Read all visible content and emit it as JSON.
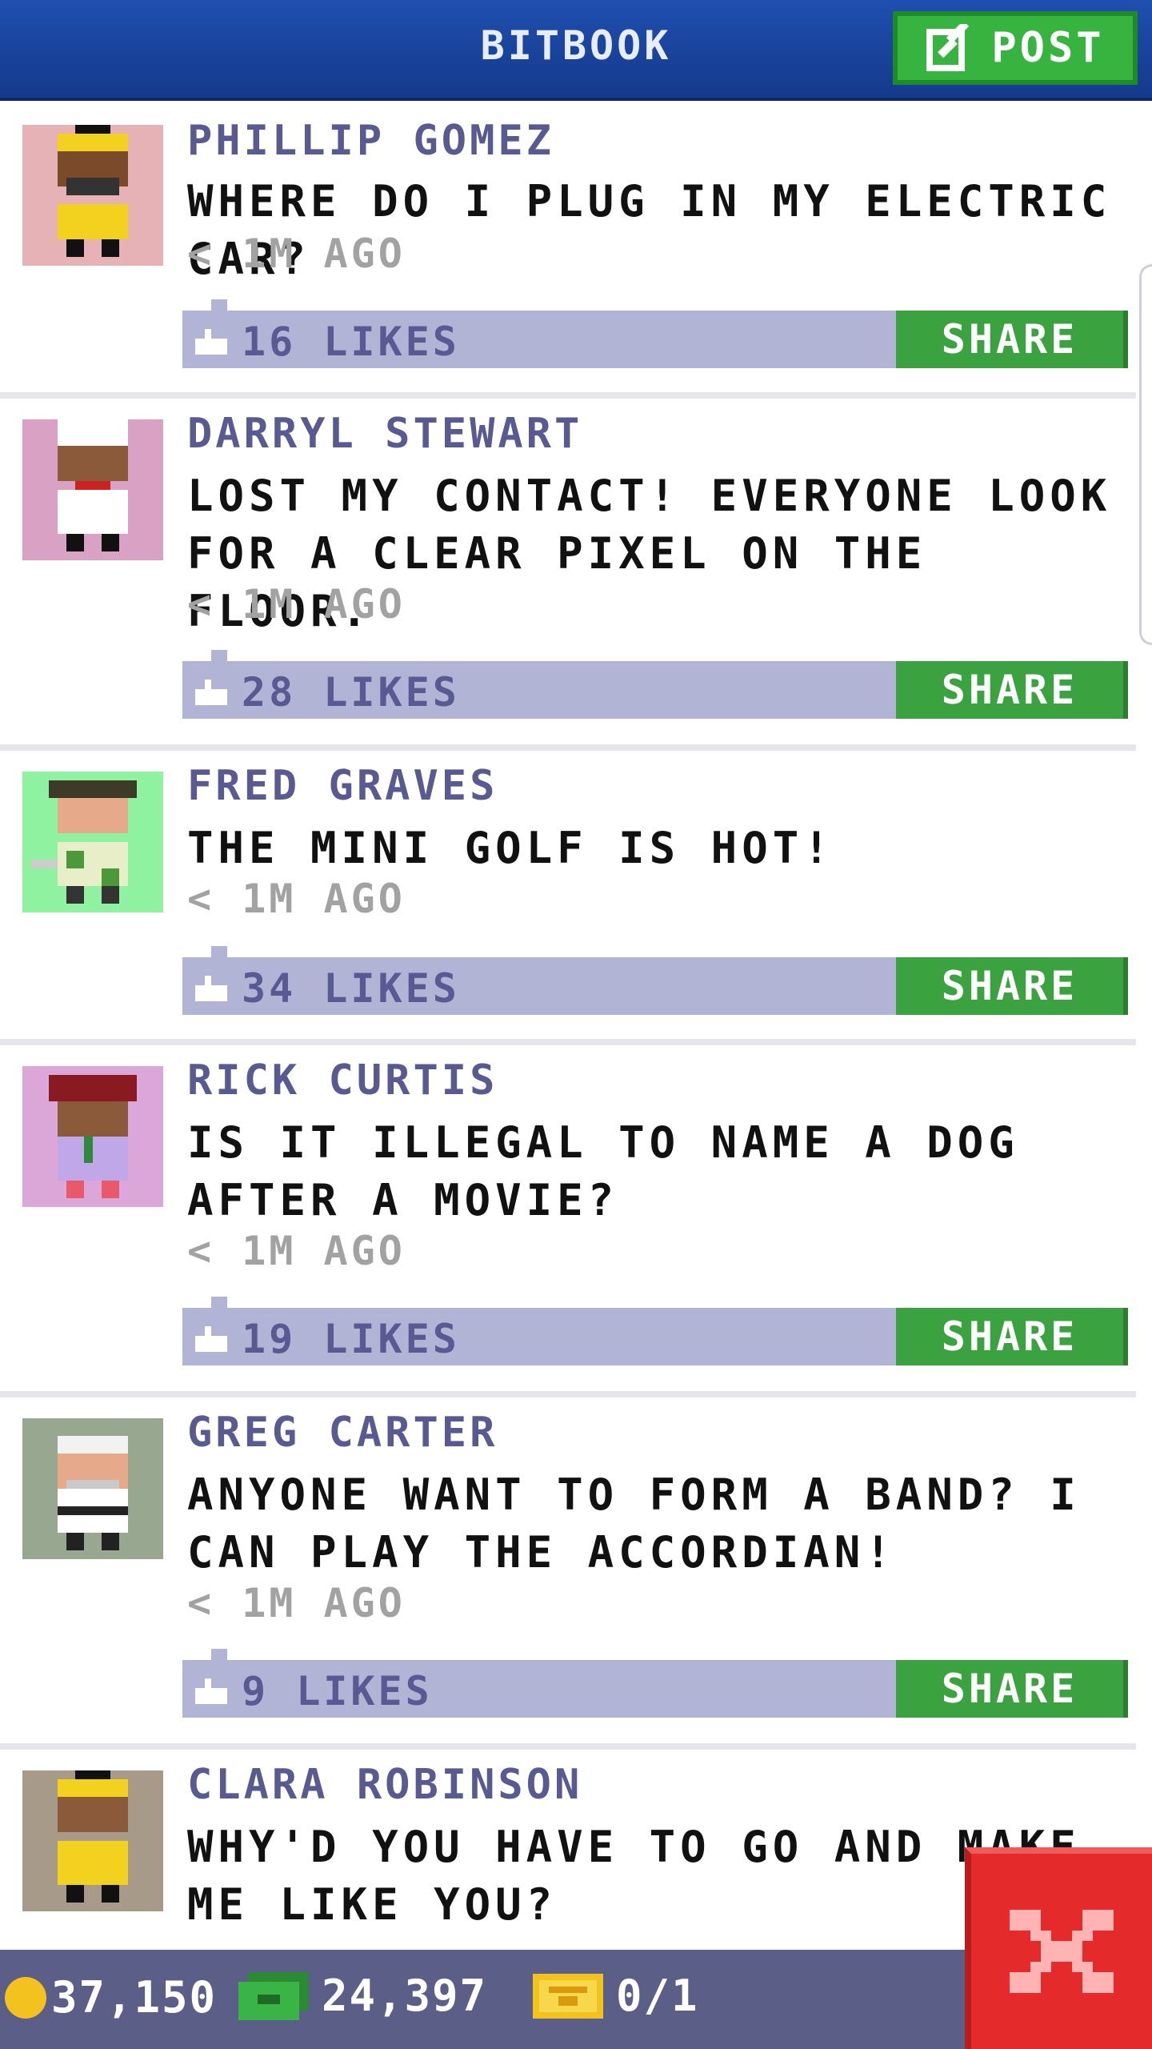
{
  "header": {
    "title": "BITBOOK",
    "post_label": "POST"
  },
  "posts": [
    {
      "author": "PHILLIP GOMEZ",
      "message": "WHERE DO I PLUG IN MY ELECTRIC CAR?",
      "time": "< 1M AGO",
      "likes": "16 LIKES",
      "share_label": "SHARE",
      "avatar_bg": "#e6b2b6"
    },
    {
      "author": "DARRYL STEWART",
      "message": "LOST MY CONTACT! EVERYONE LOOK FOR A CLEAR PIXEL ON THE FLOOR.",
      "time": "< 1M AGO",
      "likes": "28 LIKES",
      "share_label": "SHARE",
      "avatar_bg": "#d9a2c4"
    },
    {
      "author": "FRED GRAVES",
      "message": "THE MINI GOLF IS HOT!",
      "time": "< 1M AGO",
      "likes": "34 LIKES",
      "share_label": "SHARE",
      "avatar_bg": "#8ef2a0"
    },
    {
      "author": "RICK CURTIS",
      "message": "IS IT ILLEGAL TO NAME A DOG AFTER A MOVIE?",
      "time": "< 1M AGO",
      "likes": "19 LIKES",
      "share_label": "SHARE",
      "avatar_bg": "#dba6d8"
    },
    {
      "author": "GREG CARTER",
      "message": "ANYONE WANT TO FORM A BAND? I CAN PLAY THE ACCORDIAN!",
      "time": "< 1M AGO",
      "likes": "9 LIKES",
      "share_label": "SHARE",
      "avatar_bg": "#98a890"
    },
    {
      "author": "CLARA ROBINSON",
      "message": "WHY'D YOU HAVE TO GO AND MAKE ME LIKE YOU?",
      "avatar_bg": "#a89a88"
    }
  ],
  "status": {
    "coins": "37,150",
    "bux": "24,397",
    "tickets": "0/1"
  },
  "colors": {
    "header": "#1f4fb0",
    "post_button": "#37b43f",
    "share_button": "#3aa23f",
    "likes_bar": "#b2b4d6",
    "author_text": "#5a5a92",
    "status_bar": "#5b5e86",
    "close_button": "#e42a2a"
  },
  "icons": {
    "post": "edit-icon",
    "like": "thumb-icon",
    "coin": "coin-icon",
    "bux": "cash-icon",
    "tickets": "ticket-icon",
    "close": "close-icon"
  }
}
